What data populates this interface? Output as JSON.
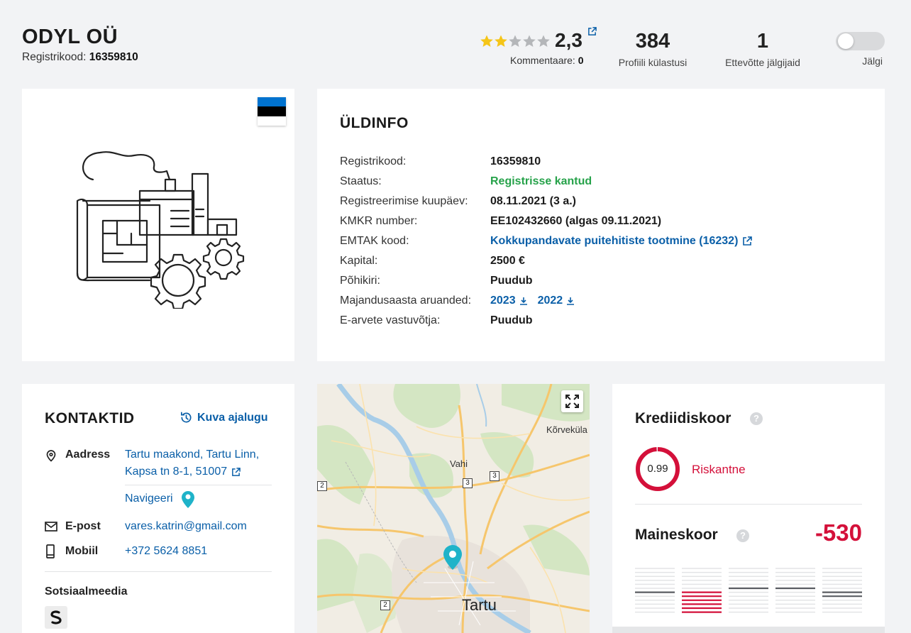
{
  "company": {
    "name": "ODYL OÜ",
    "regcode_label": "Registrikood:",
    "regcode_value": "16359810"
  },
  "rating": {
    "value": "2,3",
    "stars_filled": 2.3,
    "stars_total": 5,
    "comments_label": "Kommentaare:",
    "comments_count": "0"
  },
  "stats": {
    "visits_value": "384",
    "visits_label": "Profiili külastusi",
    "followers_value": "1",
    "followers_label": "Ettevõtte jälgijaid"
  },
  "follow": {
    "label": "Jälgi",
    "enabled": false
  },
  "general": {
    "title": "ÜLDINFO",
    "rows": [
      {
        "key": "Registrikood:",
        "value": "16359810"
      },
      {
        "key": "Staatus:",
        "value": "Registrisse kantud"
      },
      {
        "key": "Registreerimise kuupäev:",
        "value": "08.11.2021 (3 a.)"
      },
      {
        "key": "KMKR number:",
        "value": "EE102432660 (algas 09.11.2021)"
      },
      {
        "key": "EMTAK kood:",
        "value": "Kokkupandavate puitehitiste tootmine (16232)"
      },
      {
        "key": "Kapital:",
        "value": "2500 €"
      },
      {
        "key": "Põhikiri:",
        "value": "Puudub"
      },
      {
        "key": "Majandusaasta aruanded:",
        "value": ""
      },
      {
        "key": "E-arvete vastuvõtja:",
        "value": "Puudub"
      }
    ],
    "reports": [
      "2023",
      "2022"
    ]
  },
  "contacts": {
    "title": "KONTAKTID",
    "history_label": "Kuva ajalugu",
    "address_label": "Aadress",
    "address_line1": "Tartu maakond, Tartu Linn,",
    "address_line2": "Kapsa tn 8-1, 51007",
    "navigate_label": "Navigeeri",
    "email_label": "E-post",
    "email_value": "vares.katrin@gmail.com",
    "mobile_label": "Mobiil",
    "mobile_value": "+372 5624 8851",
    "social_title": "Sotsiaalmeedia"
  },
  "map": {
    "labels": {
      "korvekula": "Kõrveküla",
      "vahi": "Vahi",
      "tartu": "Tartu"
    },
    "road_signs": {
      "a": "2",
      "b": "3",
      "c": "3",
      "d": "2"
    }
  },
  "credit": {
    "title": "Krediidiskoor",
    "score": "0.99",
    "score_fraction": 0.99,
    "risk_label": "Riskantne",
    "reputation_title": "Maineskoor",
    "reputation_value": "-530",
    "help_symbol": "?",
    "colors": {
      "risk": "#d4103a",
      "accent_link": "#0a5fa8",
      "status_green": "#26a24a"
    }
  }
}
